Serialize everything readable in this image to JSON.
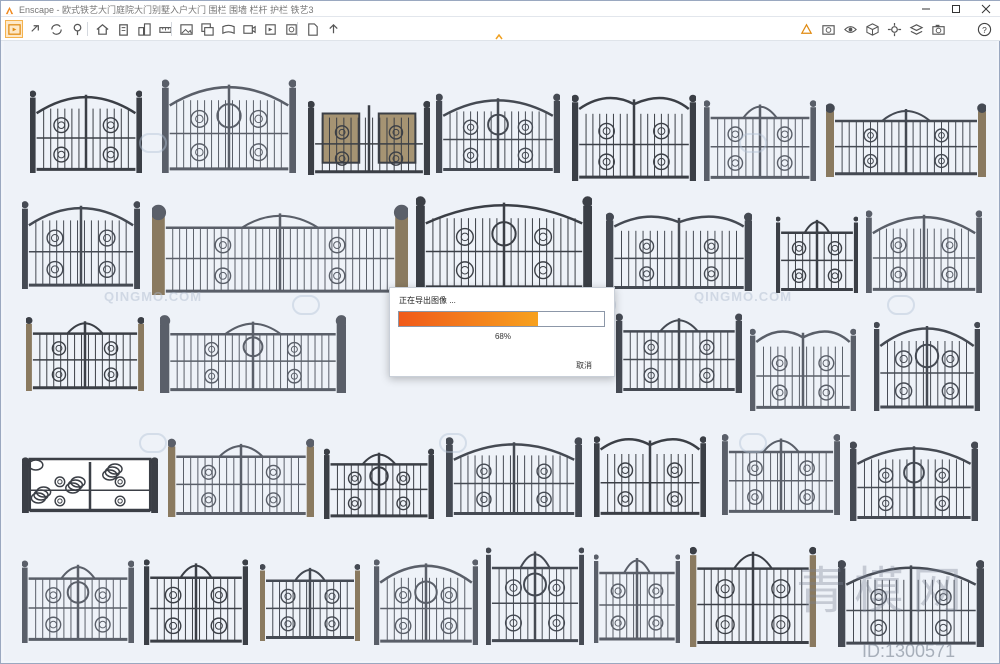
{
  "window": {
    "title": "Enscape - 欧式铁艺大门庭院大门别墅入户大门 围栏 围墙 栏杆 护栏 铁艺3",
    "accent_color": "#f4a020"
  },
  "title_controls": {
    "minimize_icon": "minimize-icon",
    "maximize_icon": "maximize-icon",
    "close_icon": "close-icon"
  },
  "toolbar": {
    "left_icons": [
      "start-icon",
      "link-icon",
      "sync-icon",
      "pin-icon",
      "home-icon",
      "building-icon",
      "buildings-icon",
      "ruler-icon",
      "export-image-icon",
      "batch-render-icon",
      "panorama-icon",
      "video-export-icon",
      "walkthrough-icon",
      "capture-icon",
      "file-icon",
      "upload-icon"
    ],
    "right_icons": [
      "visual-settings-icon",
      "screenshot-icon",
      "view-icon",
      "cube-icon",
      "settings-icon",
      "layers-icon",
      "camera-icon",
      "help-icon"
    ],
    "help_label": "?"
  },
  "gallery": {
    "gate_count": 37
  },
  "watermarks": {
    "site_text": "QINGMO.COM",
    "big_text": "青模网",
    "id_text": "ID:1300571"
  },
  "export_dialog": {
    "title": "正在导出图像 ...",
    "progress_value": 0.68,
    "progress_label": "68%",
    "cancel_label": "取消"
  }
}
